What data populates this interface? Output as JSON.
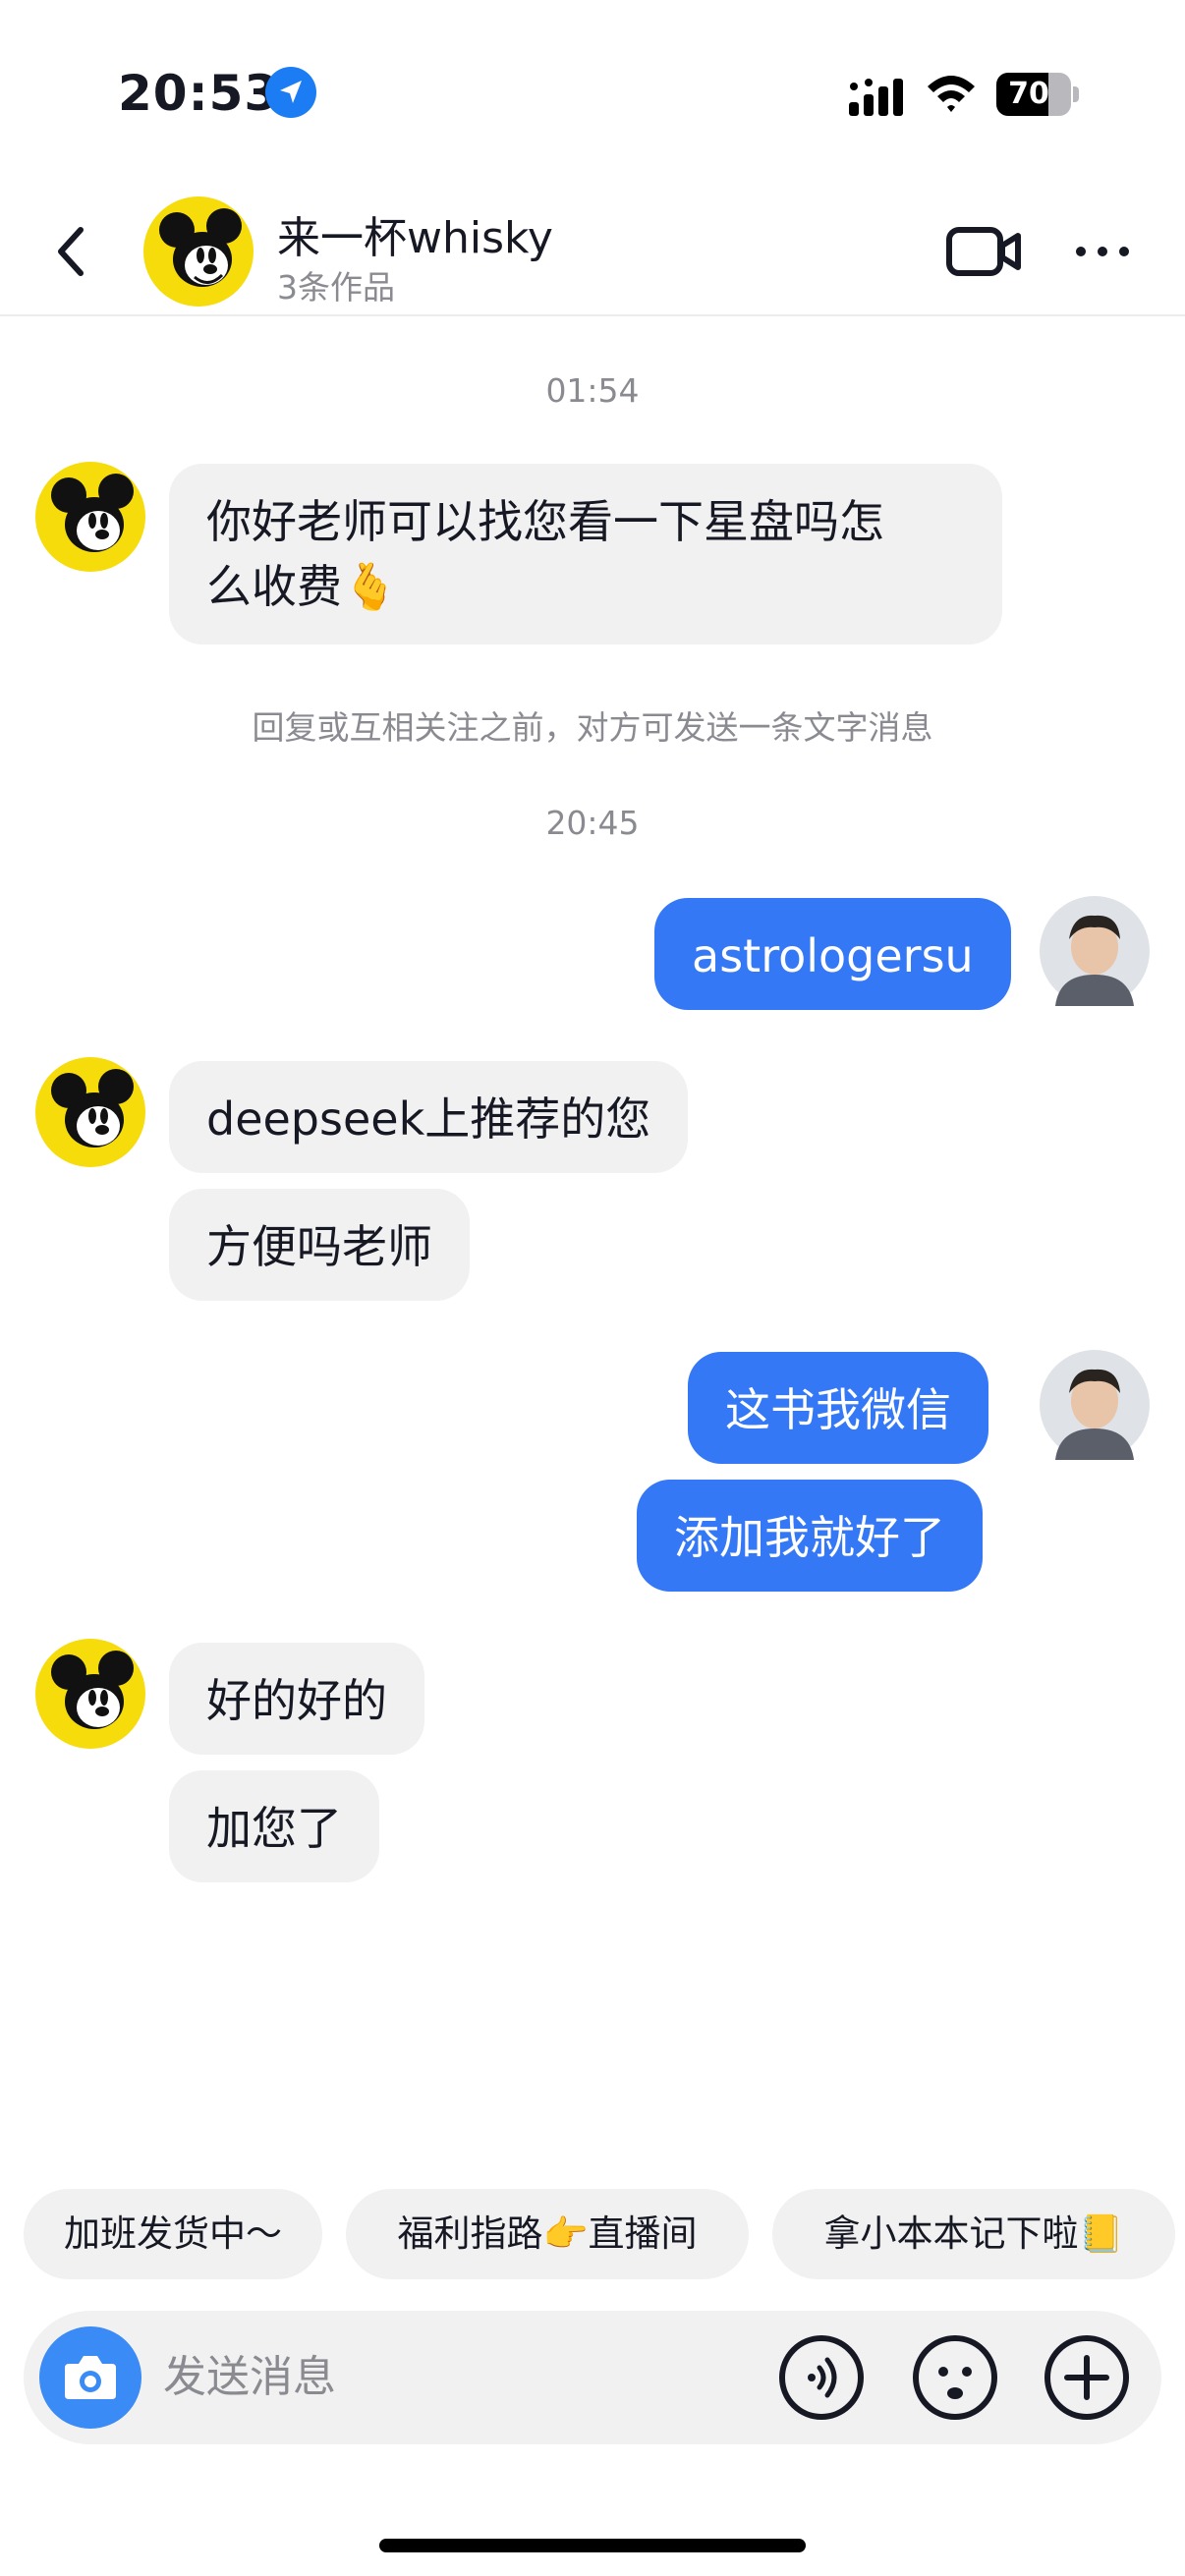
{
  "status_bar": {
    "time": "20:53",
    "battery": "70",
    "battery_level": 0.7
  },
  "header": {
    "title": "来一杯whisky",
    "subtitle": "3条作品"
  },
  "messages": {
    "time1": "01:54",
    "m1": "你好老师可以找您看一下星盘吗怎\n么收费🫰",
    "notice": "回复或互相关注之前，对方可发送一条文字消息",
    "time2": "20:45",
    "m2": "astrologersu",
    "m3": "deepseek上推荐的您",
    "m4": "方便吗老师",
    "m5": "这书我微信",
    "m6": "添加我就好了",
    "m7": "好的好的",
    "m8": "加您了"
  },
  "quick_replies": [
    "加班发货中～",
    "福利指路👉直播间",
    "拿小本本记下啦📒"
  ],
  "input": {
    "placeholder": "发送消息"
  },
  "icons": {
    "location": "location-arrow-icon",
    "camera": "camera-icon",
    "voice": "voice-icon",
    "emoji": "emoji-icon",
    "plus": "plus-icon",
    "video": "video-call-icon",
    "more": "more-icon",
    "back": "back-icon"
  },
  "colors": {
    "accent": "#3478f6",
    "bubble_in": "#f1f1f2",
    "muted": "#8a8b91",
    "avatar_yellow": "#f5dc0a"
  }
}
